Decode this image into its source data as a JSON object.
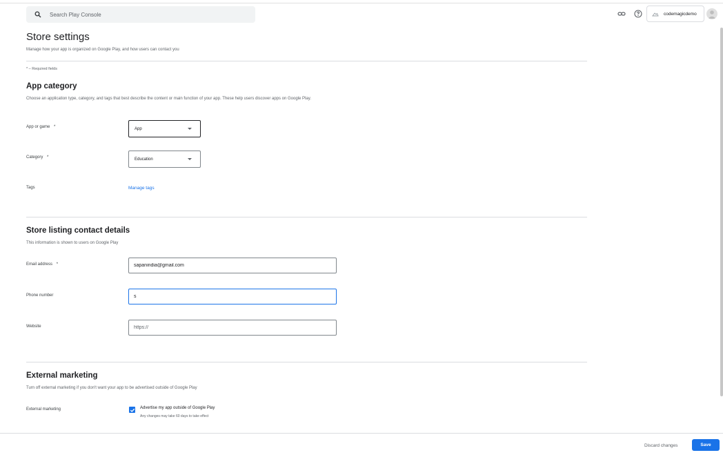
{
  "header": {
    "search_placeholder": "Search Play Console",
    "account_name": "codemagicdemo",
    "icons": [
      "search-icon",
      "link-icon",
      "help-icon",
      "app-thumbnail-icon",
      "avatar-icon"
    ]
  },
  "page": {
    "title": "Store settings",
    "subtitle": "Manage how your app is organized on Google Play, and how users can contact you",
    "required_note": "* – Required fields"
  },
  "app_category": {
    "title": "App category",
    "description": "Choose an application type, category, and tags that best describe the content or main function of your app. These help users discover apps on Google Play.",
    "app_or_game_label": "App or game",
    "app_or_game_value": "App",
    "category_label": "Category",
    "category_value": "Education",
    "tags_label": "Tags",
    "manage_tags_link": "Manage tags",
    "required_mark": "*"
  },
  "contact": {
    "title": "Store listing contact details",
    "description": "This information is shown to users on Google Play",
    "email_label": "Email address",
    "email_value": "sapanindia@gmail.com",
    "phone_label": "Phone number",
    "phone_value": "s",
    "website_label": "Website",
    "website_placeholder": "https://"
  },
  "marketing": {
    "title": "External marketing",
    "description": "Turn off external marketing if you don't want your app to be advertised outside of Google Play",
    "label": "External marketing",
    "checkbox_label": "Advertise my app outside of Google Play",
    "checkbox_note": "Any changes may take 60 days to take effect",
    "checked": true
  },
  "footer": {
    "discard_label": "Discard changes",
    "save_label": "Save"
  },
  "colors": {
    "accent": "#1a73e8",
    "text": "#202124",
    "muted": "#5f6368",
    "divider": "#dadce0"
  }
}
